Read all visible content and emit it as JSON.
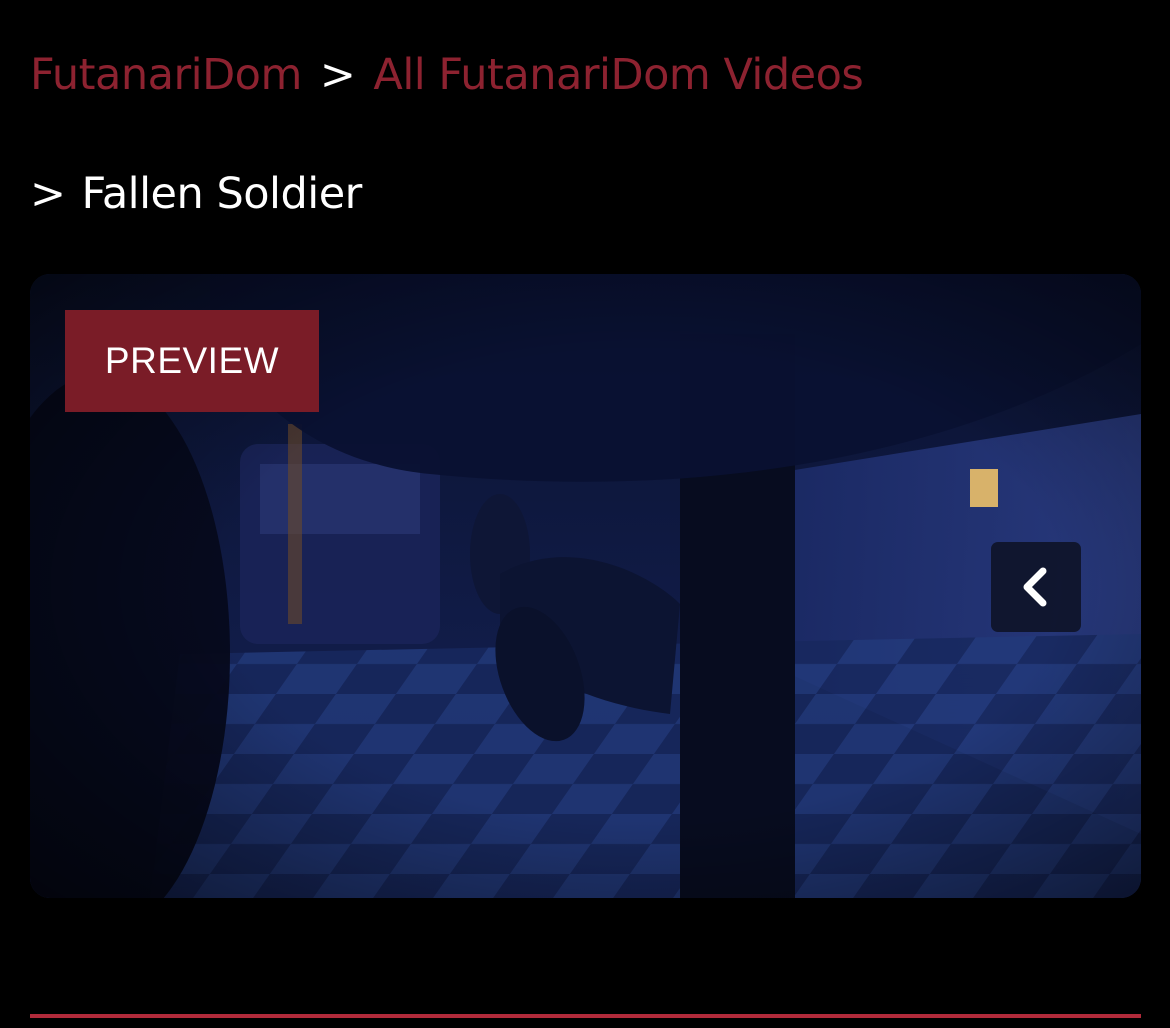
{
  "breadcrumb": {
    "home_label": "FutanariDom",
    "separator": ">",
    "section_label": "All FutanariDom Videos",
    "current_label": "Fallen Soldier"
  },
  "player": {
    "badge_label": "PREVIEW",
    "nav_icon": "chevron-left-icon"
  },
  "colors": {
    "accent": "#8d2230",
    "badge": "#7a1c27",
    "rule": "#b02a3a",
    "background": "#000000"
  }
}
